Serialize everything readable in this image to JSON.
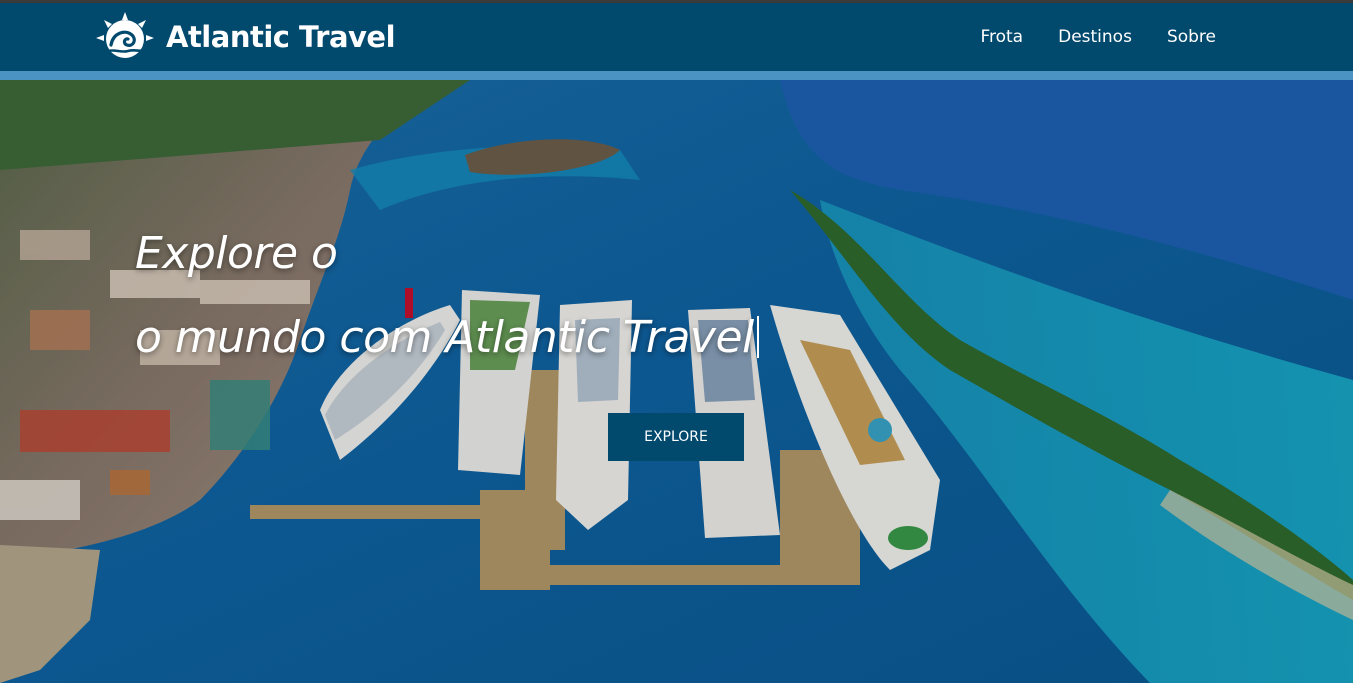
{
  "brand": {
    "name": "Atlantic Travel",
    "logo_icon": "wave-sun-icon"
  },
  "nav": {
    "items": [
      "Frota",
      "Destinos",
      "Sobre"
    ]
  },
  "hero": {
    "line1": "Explore o",
    "line2": "o mundo com Atlantic Travel",
    "cta_label": "EXPLORE"
  },
  "colors": {
    "navbar": "#02496e",
    "stripe": "#4a93c2",
    "text": "#ffffff"
  }
}
